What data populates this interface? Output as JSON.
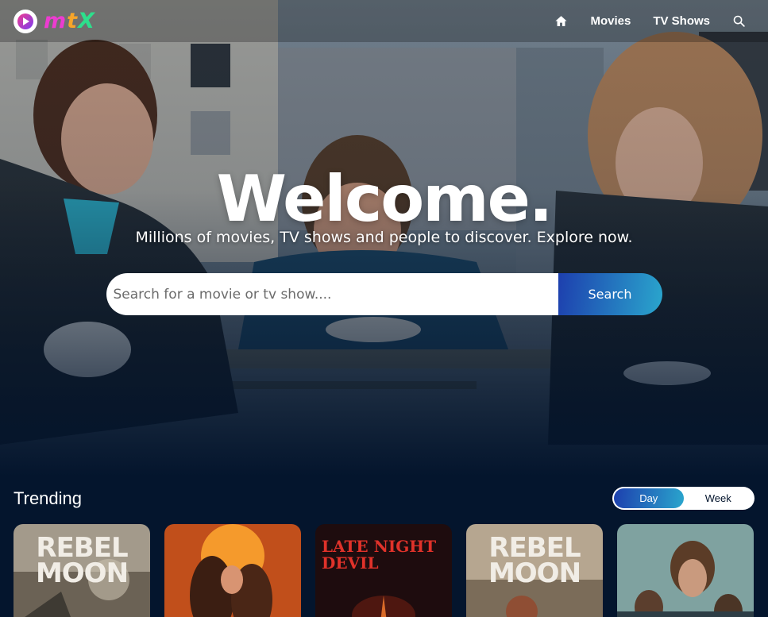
{
  "header": {
    "logo_text": "mtX",
    "nav": {
      "home_icon": "home-icon",
      "movies_label": "Movies",
      "tv_label": "TV Shows",
      "search_icon": "search-icon"
    }
  },
  "hero": {
    "title": "Welcome.",
    "subtitle": "Millions of movies, TV shows and people to discover. Explore now.",
    "search_placeholder": "Search for a movie or tv show....",
    "search_button": "Search"
  },
  "trending": {
    "title": "Trending",
    "tabs": {
      "day": "Day",
      "week": "Week",
      "active": "Day"
    },
    "cards": [
      {
        "poster_text": "REBEL MOON"
      },
      {
        "poster_text": ""
      },
      {
        "poster_text": "LATE NIGHT DEVIL"
      },
      {
        "poster_text": "REBEL MOON"
      },
      {
        "poster_text": ""
      }
    ]
  },
  "colors": {
    "background": "#04152d",
    "accent_start": "#1d3fae",
    "accent_end": "#2aa6cd",
    "logo_pink": "#ec3cd0",
    "logo_orange": "#f7a52a",
    "logo_green": "#2ddf8c"
  }
}
